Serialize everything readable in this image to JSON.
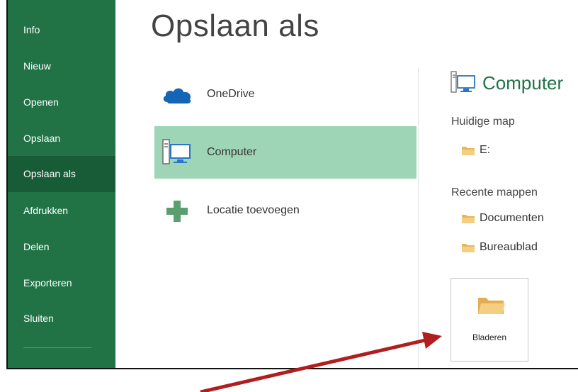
{
  "sidebar": {
    "items": [
      {
        "label": "Info"
      },
      {
        "label": "Nieuw"
      },
      {
        "label": "Openen"
      },
      {
        "label": "Opslaan"
      },
      {
        "label": "Opslaan als",
        "active": true
      },
      {
        "label": "Afdrukken"
      },
      {
        "label": "Delen"
      },
      {
        "label": "Exporteren"
      },
      {
        "label": "Sluiten"
      }
    ]
  },
  "page": {
    "title": "Opslaan als"
  },
  "locations": [
    {
      "label": "OneDrive",
      "icon": "onedrive-cloud-icon"
    },
    {
      "label": "Computer",
      "icon": "computer-icon",
      "selected": true
    },
    {
      "label": "Locatie toevoegen",
      "icon": "plus-icon"
    }
  ],
  "right_panel": {
    "title": "Computer",
    "current_folder_heading": "Huidige map",
    "current_folder": "E:",
    "recent_heading": "Recente mappen",
    "recent_folders": [
      "Documenten",
      "Bureaublad"
    ],
    "browse_label": "Bladeren"
  },
  "colors": {
    "sidebar": "#217346",
    "sidebar_active": "#185c37",
    "selected_location": "#9fd5b7",
    "accent_text": "#217346",
    "folder": "#f2c571",
    "annotation_arrow": "#b01e1e"
  }
}
